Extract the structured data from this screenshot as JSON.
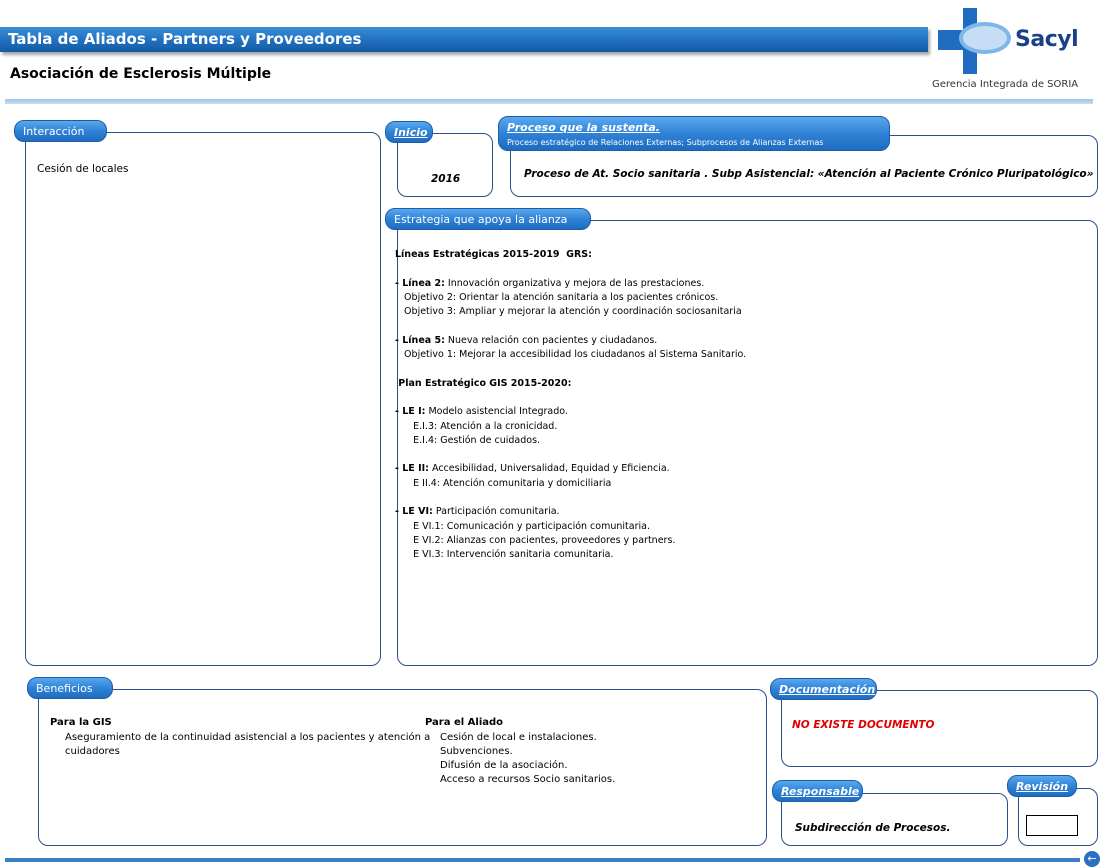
{
  "header": {
    "title": "Tabla de Aliados - Partners y Proveedores",
    "subtitle": "Asociación de Esclerosis Múltiple"
  },
  "logo": {
    "name": "Sacyl",
    "caption": "Gerencia Integrada de SORIA",
    "icon": "sacyl-cross-logo",
    "colors": {
      "blue": "#1f6cc0",
      "dark": "#1b3f8a"
    }
  },
  "interaccion": {
    "label": "Interacción",
    "content": "Cesión de locales"
  },
  "inicio": {
    "label": "Inicio",
    "value": "2016"
  },
  "proceso": {
    "label": "Proceso que la sustenta.",
    "sublabel": "Proceso estratégico de Relaciones Externas; Subprocesos de Alianzas Externas",
    "value": "Proceso de At. Socio sanitaria . Subp Asistencial: «Atención al Paciente Crónico Pluripatológico»"
  },
  "estrategia": {
    "label": "Estrategia que apoya la alianza",
    "lines": [
      {
        "bold": "Líneas Estratégicas 2015-2019  GRS:",
        "text": ""
      },
      {
        "bold": "",
        "text": ""
      },
      {
        "bold": "- Línea 2:",
        "text": " Innovación organizativa y mejora de las prestaciones."
      },
      {
        "bold": "",
        "text": "   Objetivo 2: Orientar la atención sanitaria a los pacientes crónicos."
      },
      {
        "bold": "",
        "text": "   Objetivo 3: Ampliar y mejorar la atención y coordinación sociosanitaria"
      },
      {
        "bold": "",
        "text": ""
      },
      {
        "bold": "- Línea 5:",
        "text": " Nueva relación con pacientes y ciudadanos."
      },
      {
        "bold": "",
        "text": "   Objetivo 1: Mejorar la accesibilidad los ciudadanos al Sistema Sanitario."
      },
      {
        "bold": "",
        "text": ""
      },
      {
        "bold": " Plan Estratégico GIS 2015-2020:",
        "text": ""
      },
      {
        "bold": "",
        "text": ""
      },
      {
        "bold": "- LE I:",
        "text": " Modelo asistencial Integrado."
      },
      {
        "bold": "",
        "text": "      E.I.3: Atención a la cronicidad."
      },
      {
        "bold": "",
        "text": "      E.I.4: Gestión de cuidados."
      },
      {
        "bold": "",
        "text": ""
      },
      {
        "bold": "- LE II:",
        "text": " Accesibilidad, Universalidad, Equidad y Eficiencia."
      },
      {
        "bold": "",
        "text": "      E II.4: Atención comunitaria y domiciliaria"
      },
      {
        "bold": "",
        "text": ""
      },
      {
        "bold": "- LE VI:",
        "text": " Participación comunitaria."
      },
      {
        "bold": "",
        "text": "      E VI.1: Comunicación y participación comunitaria."
      },
      {
        "bold": "",
        "text": "      E VI.2: Alianzas con pacientes, proveedores y partners."
      },
      {
        "bold": "",
        "text": "      E VI.3: Intervención sanitaria comunitaria."
      }
    ]
  },
  "beneficios": {
    "label": "Beneficios",
    "gis_title": "Para la GIS",
    "gis_text_1": "Aseguramiento de la continuidad asistencial a los pacientes y atención a",
    "gis_text_2": "cuidadores",
    "aliado_title": "Para el Aliado",
    "aliado_items": [
      "Cesión de local e instalaciones.",
      "Subvenciones.",
      "Difusión de la asociación.",
      "Acceso a recursos Socio sanitarios."
    ]
  },
  "documentacion": {
    "label": "Documentación",
    "value": "NO EXISTE DOCUMENTO",
    "value_color": "#e00000"
  },
  "responsable": {
    "label": "Responsable",
    "value": "Subdirección de Procesos."
  },
  "revision": {
    "label": "Revisión"
  },
  "footer": {
    "back_icon": "back-arrow-icon"
  }
}
